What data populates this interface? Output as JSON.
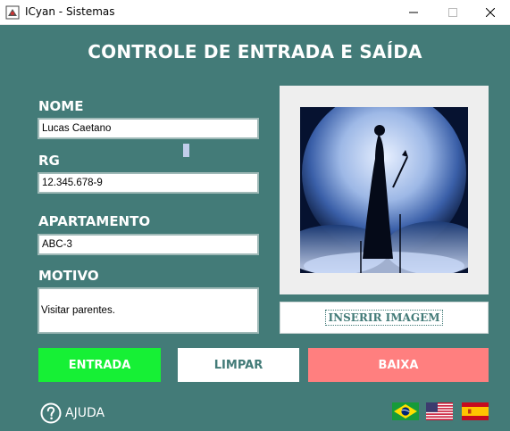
{
  "window": {
    "title": "ICyan - Sistemas",
    "minimize": "—",
    "maximize": "☐",
    "close": "✕"
  },
  "form": {
    "heading": "CONTROLE DE ENTRADA E SAÍDA",
    "nome_label": "NOME",
    "nome_value": "Lucas Caetano",
    "rg_label": "RG",
    "rg_value": "12.345.678-9",
    "apartamento_label": "APARTAMENTO",
    "apartamento_value": "ABC-3",
    "motivo_label": "MOTIVO",
    "motivo_value": "Visitar parentes."
  },
  "image_panel": {
    "insert_label": "INSERIR IMAGEM"
  },
  "actions": {
    "entrada": "ENTRADA",
    "limpar": "LIMPAR",
    "baixa": "BAIXA"
  },
  "footer": {
    "help_label": "AJUDA",
    "languages": [
      "pt-BR flag",
      "en-US flag",
      "es-ES flag"
    ]
  },
  "colors": {
    "background": "#437b78",
    "entrada": "#16f035",
    "baixa": "#ff7f7f",
    "limpar_text": "#437b78"
  }
}
